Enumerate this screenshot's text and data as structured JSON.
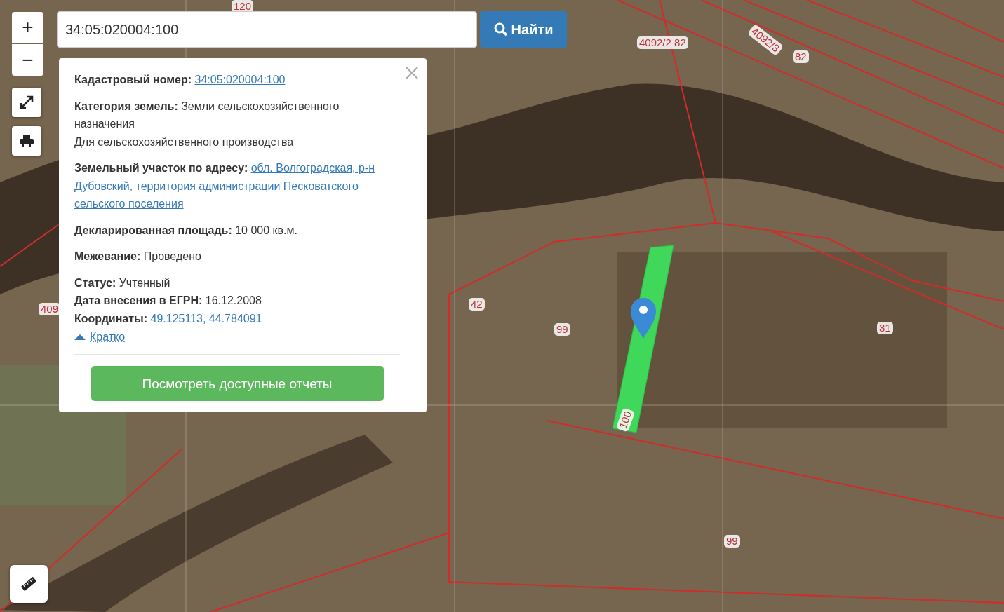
{
  "search": {
    "value": "34:05:020004:100",
    "button": "Найти"
  },
  "zoom_controls": {
    "zoom_in": "+",
    "zoom_out": "−"
  },
  "popup": {
    "sections": [
      [
        {
          "label": "Кадастровый номер:",
          "value": "34:05:020004:100",
          "kind": "link"
        }
      ],
      [
        {
          "label": "Категория земель:",
          "value": "Земли сельскохозяйственного назначения",
          "kind": "text",
          "note": "Для сельскохозяйственного производства"
        }
      ],
      [
        {
          "label": "Земельный участок по адресу:",
          "value": "обл. Волгоградская, р-н Дубовский, территория администрации Песковатского сельского поселения",
          "kind": "link"
        }
      ],
      [
        {
          "label": "Декларированная площадь:",
          "value": "10 000 кв.м.",
          "kind": "text"
        }
      ],
      [
        {
          "label": "Межевание:",
          "value": "Проведено",
          "kind": "text"
        }
      ],
      [
        {
          "label": "Статус:",
          "value": "Учтенный",
          "kind": "text"
        },
        {
          "label": "Дата внесения в ЕГРН:",
          "value": "16.12.2008",
          "kind": "text"
        },
        {
          "label": "Координаты:",
          "value": "49.125113, 44.784091",
          "kind": "coords"
        }
      ]
    ],
    "toggle": {
      "label": "Кратко",
      "expanded": true
    },
    "action": "Посмотреть доступные отчеты"
  },
  "map_labels": [
    {
      "text": "120"
    },
    {
      "text": "4092/2 82"
    },
    {
      "text": "4092/3"
    },
    {
      "text": "82"
    },
    {
      "text": "409"
    },
    {
      "text": "42"
    },
    {
      "text": "99"
    },
    {
      "text": "31"
    },
    {
      "text": "100"
    },
    {
      "text": "99"
    }
  ]
}
